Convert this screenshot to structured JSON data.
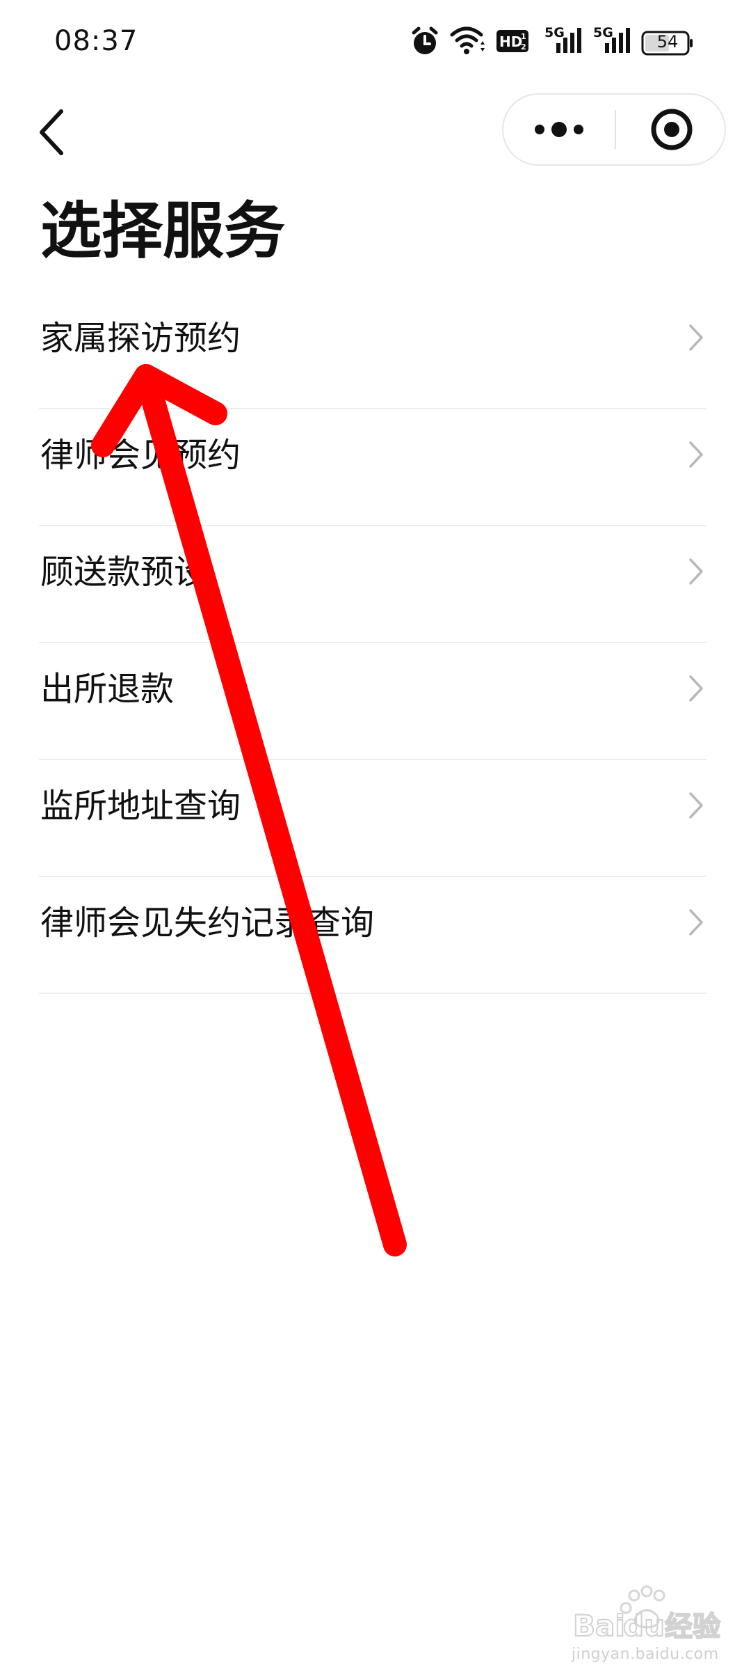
{
  "status_bar": {
    "time": "08:37",
    "signal_1_label": "5G",
    "signal_2_label": "5G",
    "battery_level": "54",
    "icons": [
      "alarm-icon",
      "wifi-icon",
      "hd-icon",
      "signal-icon",
      "signal-icon",
      "battery-icon"
    ]
  },
  "nav": {
    "back_icon": "chevron-left-icon",
    "more_icon": "more-dots-icon",
    "close_icon": "record-circle-icon"
  },
  "page": {
    "title": "选择服务"
  },
  "services": [
    {
      "label": "家属探访预约"
    },
    {
      "label": "律师会见预约"
    },
    {
      "label": "顾送款预设"
    },
    {
      "label": "出所退款"
    },
    {
      "label": "监所地址查询"
    },
    {
      "label": "律师会见失约记录查询"
    }
  ],
  "annotation": {
    "color": "#ff0000",
    "icon": "red-arrow"
  },
  "watermark": {
    "url": "jingyan.baidu.com"
  },
  "colors": {
    "background": "#ffffff",
    "divider": "#ededed",
    "chevron": "#b8b8b8",
    "text": "#111111"
  }
}
